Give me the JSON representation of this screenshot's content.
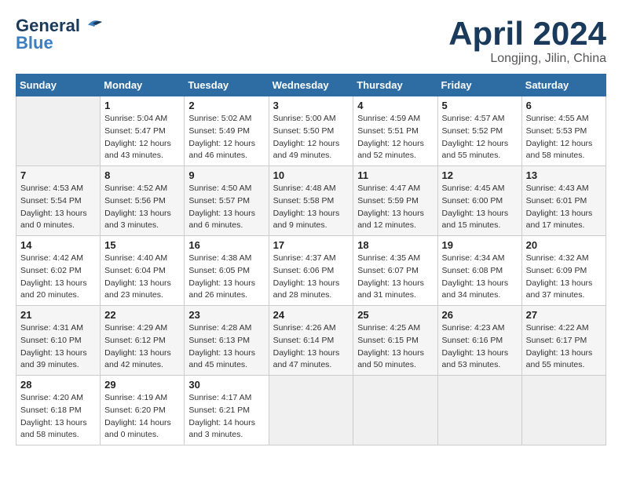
{
  "header": {
    "logo_line1": "General",
    "logo_line2": "Blue",
    "month": "April 2024",
    "location": "Longjing, Jilin, China"
  },
  "weekdays": [
    "Sunday",
    "Monday",
    "Tuesday",
    "Wednesday",
    "Thursday",
    "Friday",
    "Saturday"
  ],
  "weeks": [
    [
      {
        "day": "",
        "sunrise": "",
        "sunset": "",
        "daylight": ""
      },
      {
        "day": "1",
        "sunrise": "Sunrise: 5:04 AM",
        "sunset": "Sunset: 5:47 PM",
        "daylight": "Daylight: 12 hours and 43 minutes."
      },
      {
        "day": "2",
        "sunrise": "Sunrise: 5:02 AM",
        "sunset": "Sunset: 5:49 PM",
        "daylight": "Daylight: 12 hours and 46 minutes."
      },
      {
        "day": "3",
        "sunrise": "Sunrise: 5:00 AM",
        "sunset": "Sunset: 5:50 PM",
        "daylight": "Daylight: 12 hours and 49 minutes."
      },
      {
        "day": "4",
        "sunrise": "Sunrise: 4:59 AM",
        "sunset": "Sunset: 5:51 PM",
        "daylight": "Daylight: 12 hours and 52 minutes."
      },
      {
        "day": "5",
        "sunrise": "Sunrise: 4:57 AM",
        "sunset": "Sunset: 5:52 PM",
        "daylight": "Daylight: 12 hours and 55 minutes."
      },
      {
        "day": "6",
        "sunrise": "Sunrise: 4:55 AM",
        "sunset": "Sunset: 5:53 PM",
        "daylight": "Daylight: 12 hours and 58 minutes."
      }
    ],
    [
      {
        "day": "7",
        "sunrise": "Sunrise: 4:53 AM",
        "sunset": "Sunset: 5:54 PM",
        "daylight": "Daylight: 13 hours and 0 minutes."
      },
      {
        "day": "8",
        "sunrise": "Sunrise: 4:52 AM",
        "sunset": "Sunset: 5:56 PM",
        "daylight": "Daylight: 13 hours and 3 minutes."
      },
      {
        "day": "9",
        "sunrise": "Sunrise: 4:50 AM",
        "sunset": "Sunset: 5:57 PM",
        "daylight": "Daylight: 13 hours and 6 minutes."
      },
      {
        "day": "10",
        "sunrise": "Sunrise: 4:48 AM",
        "sunset": "Sunset: 5:58 PM",
        "daylight": "Daylight: 13 hours and 9 minutes."
      },
      {
        "day": "11",
        "sunrise": "Sunrise: 4:47 AM",
        "sunset": "Sunset: 5:59 PM",
        "daylight": "Daylight: 13 hours and 12 minutes."
      },
      {
        "day": "12",
        "sunrise": "Sunrise: 4:45 AM",
        "sunset": "Sunset: 6:00 PM",
        "daylight": "Daylight: 13 hours and 15 minutes."
      },
      {
        "day": "13",
        "sunrise": "Sunrise: 4:43 AM",
        "sunset": "Sunset: 6:01 PM",
        "daylight": "Daylight: 13 hours and 17 minutes."
      }
    ],
    [
      {
        "day": "14",
        "sunrise": "Sunrise: 4:42 AM",
        "sunset": "Sunset: 6:02 PM",
        "daylight": "Daylight: 13 hours and 20 minutes."
      },
      {
        "day": "15",
        "sunrise": "Sunrise: 4:40 AM",
        "sunset": "Sunset: 6:04 PM",
        "daylight": "Daylight: 13 hours and 23 minutes."
      },
      {
        "day": "16",
        "sunrise": "Sunrise: 4:38 AM",
        "sunset": "Sunset: 6:05 PM",
        "daylight": "Daylight: 13 hours and 26 minutes."
      },
      {
        "day": "17",
        "sunrise": "Sunrise: 4:37 AM",
        "sunset": "Sunset: 6:06 PM",
        "daylight": "Daylight: 13 hours and 28 minutes."
      },
      {
        "day": "18",
        "sunrise": "Sunrise: 4:35 AM",
        "sunset": "Sunset: 6:07 PM",
        "daylight": "Daylight: 13 hours and 31 minutes."
      },
      {
        "day": "19",
        "sunrise": "Sunrise: 4:34 AM",
        "sunset": "Sunset: 6:08 PM",
        "daylight": "Daylight: 13 hours and 34 minutes."
      },
      {
        "day": "20",
        "sunrise": "Sunrise: 4:32 AM",
        "sunset": "Sunset: 6:09 PM",
        "daylight": "Daylight: 13 hours and 37 minutes."
      }
    ],
    [
      {
        "day": "21",
        "sunrise": "Sunrise: 4:31 AM",
        "sunset": "Sunset: 6:10 PM",
        "daylight": "Daylight: 13 hours and 39 minutes."
      },
      {
        "day": "22",
        "sunrise": "Sunrise: 4:29 AM",
        "sunset": "Sunset: 6:12 PM",
        "daylight": "Daylight: 13 hours and 42 minutes."
      },
      {
        "day": "23",
        "sunrise": "Sunrise: 4:28 AM",
        "sunset": "Sunset: 6:13 PM",
        "daylight": "Daylight: 13 hours and 45 minutes."
      },
      {
        "day": "24",
        "sunrise": "Sunrise: 4:26 AM",
        "sunset": "Sunset: 6:14 PM",
        "daylight": "Daylight: 13 hours and 47 minutes."
      },
      {
        "day": "25",
        "sunrise": "Sunrise: 4:25 AM",
        "sunset": "Sunset: 6:15 PM",
        "daylight": "Daylight: 13 hours and 50 minutes."
      },
      {
        "day": "26",
        "sunrise": "Sunrise: 4:23 AM",
        "sunset": "Sunset: 6:16 PM",
        "daylight": "Daylight: 13 hours and 53 minutes."
      },
      {
        "day": "27",
        "sunrise": "Sunrise: 4:22 AM",
        "sunset": "Sunset: 6:17 PM",
        "daylight": "Daylight: 13 hours and 55 minutes."
      }
    ],
    [
      {
        "day": "28",
        "sunrise": "Sunrise: 4:20 AM",
        "sunset": "Sunset: 6:18 PM",
        "daylight": "Daylight: 13 hours and 58 minutes."
      },
      {
        "day": "29",
        "sunrise": "Sunrise: 4:19 AM",
        "sunset": "Sunset: 6:20 PM",
        "daylight": "Daylight: 14 hours and 0 minutes."
      },
      {
        "day": "30",
        "sunrise": "Sunrise: 4:17 AM",
        "sunset": "Sunset: 6:21 PM",
        "daylight": "Daylight: 14 hours and 3 minutes."
      },
      {
        "day": "",
        "sunrise": "",
        "sunset": "",
        "daylight": ""
      },
      {
        "day": "",
        "sunrise": "",
        "sunset": "",
        "daylight": ""
      },
      {
        "day": "",
        "sunrise": "",
        "sunset": "",
        "daylight": ""
      },
      {
        "day": "",
        "sunrise": "",
        "sunset": "",
        "daylight": ""
      }
    ]
  ]
}
